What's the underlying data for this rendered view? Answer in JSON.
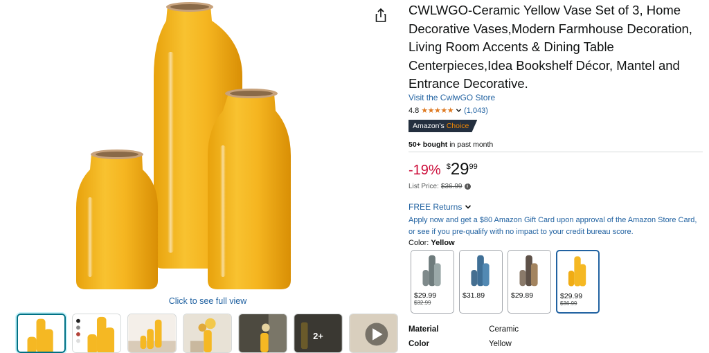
{
  "product": {
    "title": "CWLWGO-Ceramic Yellow Vase Set of 3, Home Decorative Vases,Modern Farmhouse Decoration, Living Room Accents & Dining Table Centerpieces,Idea Bookshelf Décor, Mantel and Entrance Decorative.",
    "store_link": "Visit the CwlwGO Store",
    "rating": "4.8",
    "stars": "★★★★★",
    "rating_count": "(1,043)",
    "badge_prefix": "Amazon's",
    "badge_suffix": "Choice",
    "bought_bold": "50+ bought",
    "bought_rest": "in past month",
    "discount": "-19%",
    "price_symbol": "$",
    "price_whole": "29",
    "price_fraction": "99",
    "list_price_label": "List Price:",
    "list_price_value": "$36.99",
    "free_returns": "FREE Returns",
    "gift_card_text": "Apply now and get a $80 Amazon Gift Card upon approval of the Amazon Store Card, or see if you pre-qualify with no impact to your credit bureau score.",
    "color_label": "Color:",
    "color_value": "Yellow"
  },
  "gallery": {
    "full_view_link": "Click to see full view",
    "more_count": "2+",
    "main_vase_color": "#f5b823"
  },
  "swatches": [
    {
      "price": "$29.99",
      "list": "$32.99",
      "color": "#7a8a8c"
    },
    {
      "price": "$31.89",
      "list": "",
      "color": "#4a7ea6"
    },
    {
      "price": "$29.89",
      "list": "",
      "color": "#7b6a5a"
    },
    {
      "price": "$29.99",
      "list": "$36.99",
      "color": "#f5b823"
    }
  ],
  "specs": [
    {
      "key": "Material",
      "value": "Ceramic"
    },
    {
      "key": "Color",
      "value": "Yellow"
    }
  ]
}
